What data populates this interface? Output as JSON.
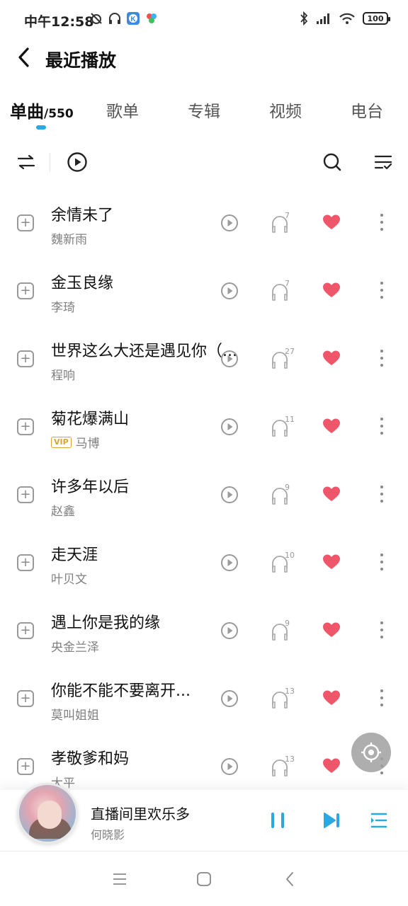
{
  "status_bar": {
    "time": "中午12:58",
    "left_icons": [
      "alarm-off-icon",
      "headphones-icon",
      "app-k-icon",
      "app-color-icon"
    ],
    "right_icons": [
      "bluetooth-icon",
      "signal-icon",
      "wifi-icon"
    ],
    "battery": "100"
  },
  "header": {
    "back_icon": "chevron-left-icon",
    "title": "最近播放"
  },
  "tabs": [
    {
      "label": "单曲",
      "count": "/550",
      "active": true
    },
    {
      "label": "歌单",
      "active": false
    },
    {
      "label": "专辑",
      "active": false
    },
    {
      "label": "视频",
      "active": false
    },
    {
      "label": "电台",
      "active": false
    }
  ],
  "toolbar": {
    "icons": [
      "shuffle-order-icon",
      "play-circle-icon",
      "search-icon",
      "list-manage-icon"
    ]
  },
  "songs": [
    {
      "title": "余情未了",
      "artist": "魏新雨",
      "plays": "7",
      "vip": false
    },
    {
      "title": "金玉良缘",
      "artist": "李琦",
      "plays": "7",
      "vip": false
    },
    {
      "title": "世界这么大还是遇见你（...",
      "artist": "程响",
      "plays": "27",
      "vip": false
    },
    {
      "title": "菊花爆满山",
      "artist": "马博",
      "plays": "11",
      "vip": true,
      "vip_label": "VIP"
    },
    {
      "title": "许多年以后",
      "artist": "赵鑫",
      "plays": "9",
      "vip": false
    },
    {
      "title": "走天涯",
      "artist": "叶贝文",
      "plays": "10",
      "vip": false
    },
    {
      "title": "遇上你是我的缘",
      "artist": "央金兰泽",
      "plays": "9",
      "vip": false
    },
    {
      "title": "你能不能不要离开...",
      "artist": "莫叫姐姐",
      "plays": "13",
      "vip": false
    },
    {
      "title": "孝敬爹和妈",
      "artist": "大平",
      "plays": "13",
      "vip": false
    }
  ],
  "now_playing": {
    "title": "直播间里欢乐多",
    "artist": "何晓影",
    "controls": [
      "pause-icon",
      "next-icon",
      "playlist-icon"
    ]
  },
  "colors": {
    "accent": "#2aa8e0",
    "heart": "#f0566a"
  },
  "nav_bar": {
    "icons": [
      "menu-icon",
      "home-icon",
      "back-icon"
    ]
  }
}
